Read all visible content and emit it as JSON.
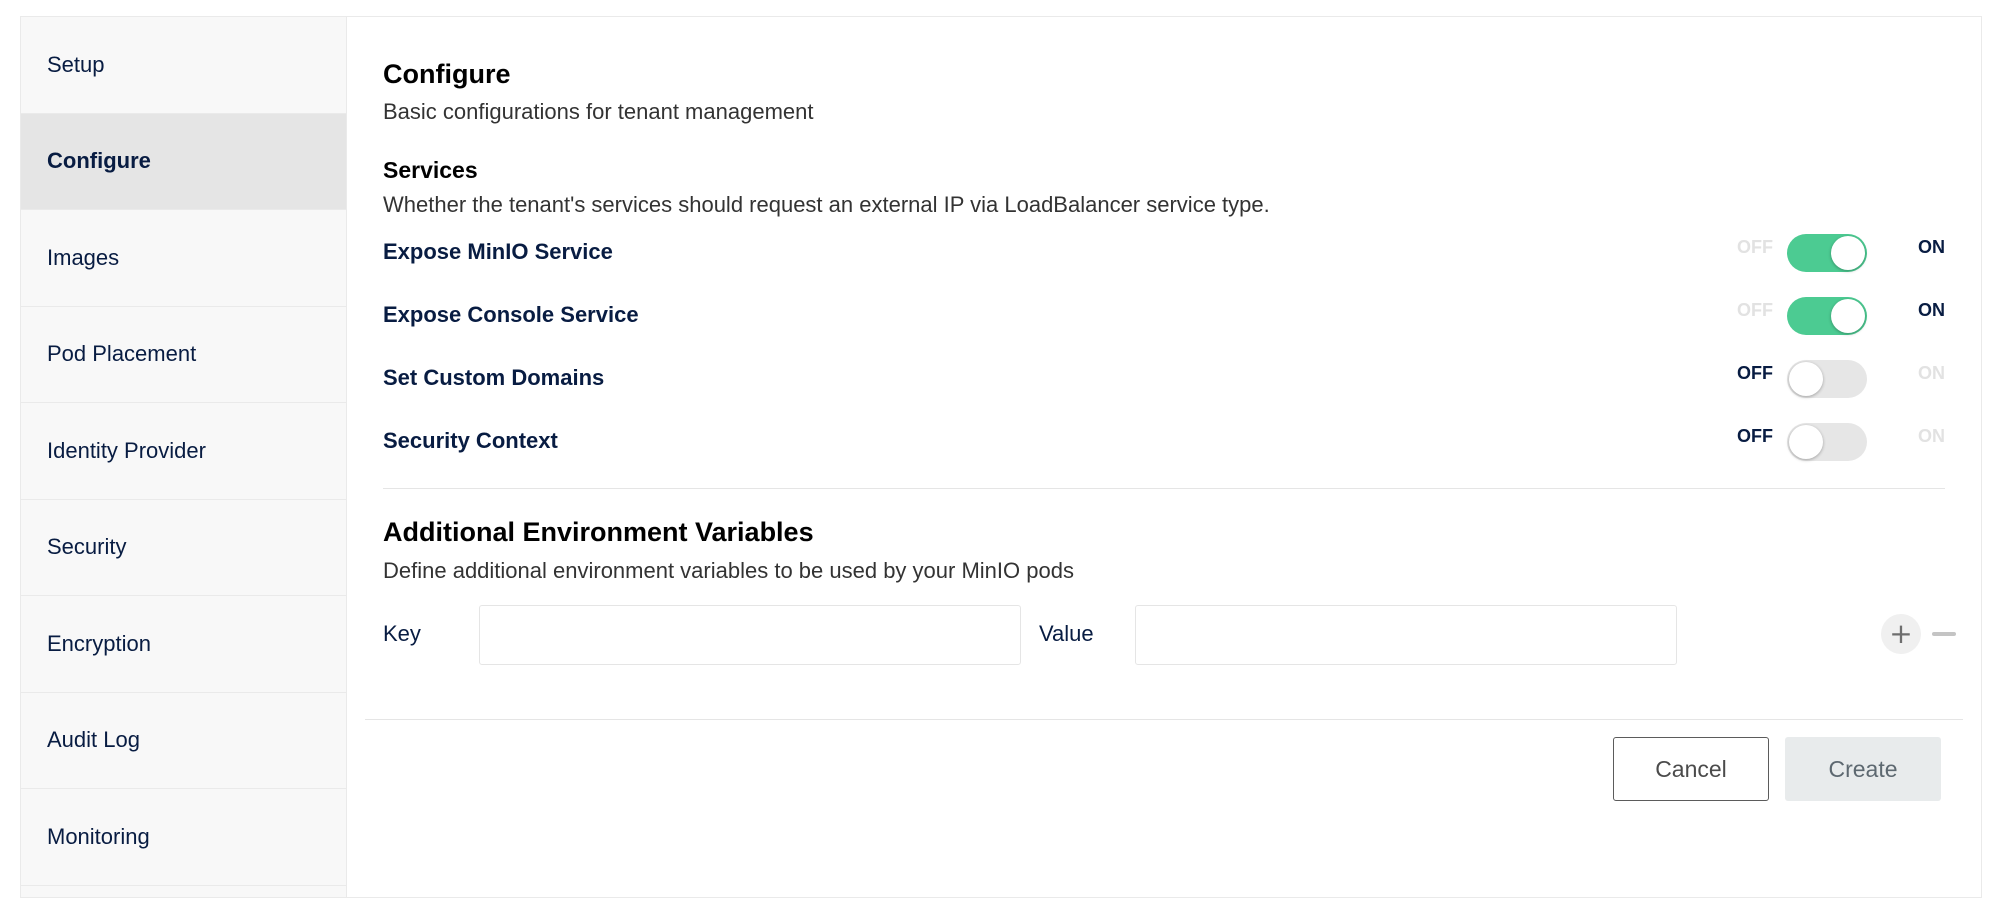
{
  "sidebar": {
    "items": [
      {
        "label": "Setup",
        "active": false
      },
      {
        "label": "Configure",
        "active": true
      },
      {
        "label": "Images",
        "active": false
      },
      {
        "label": "Pod Placement",
        "active": false
      },
      {
        "label": "Identity Provider",
        "active": false
      },
      {
        "label": "Security",
        "active": false
      },
      {
        "label": "Encryption",
        "active": false
      },
      {
        "label": "Audit Log",
        "active": false
      },
      {
        "label": "Monitoring",
        "active": false
      }
    ]
  },
  "configure": {
    "title": "Configure",
    "description": "Basic configurations for tenant management"
  },
  "services": {
    "title": "Services",
    "description": "Whether the tenant's services should request an external IP via LoadBalancer service type.",
    "off_label": "OFF",
    "on_label": "ON",
    "toggles": [
      {
        "label": "Expose MinIO Service",
        "value": "on"
      },
      {
        "label": "Expose Console Service",
        "value": "on"
      },
      {
        "label": "Set Custom Domains",
        "value": "off"
      },
      {
        "label": "Security Context",
        "value": "off"
      }
    ]
  },
  "env_vars": {
    "title": "Additional Environment Variables",
    "description": "Define additional environment variables to be used by your MinIO pods",
    "key_label": "Key",
    "value_label": "Value",
    "key_value": "",
    "value_value": "",
    "add_symbol": "+"
  },
  "footer": {
    "cancel_label": "Cancel",
    "create_label": "Create"
  },
  "colors": {
    "toggle_on": "#4ccb92",
    "toggle_off": "#e6e6e6",
    "text_primary": "#081c42",
    "active_sidebar": "#e5e5e5"
  }
}
